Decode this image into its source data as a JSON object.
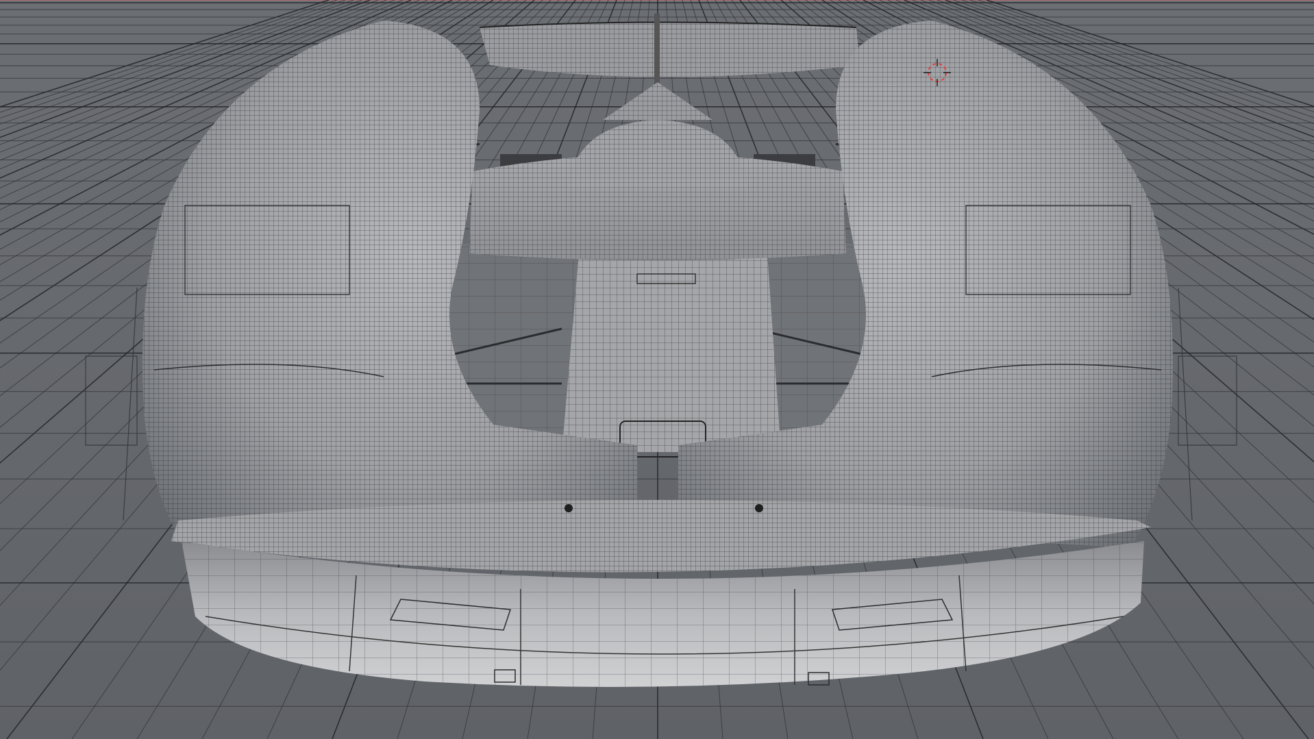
{
  "viewport": {
    "name": "3d-viewport",
    "shading": "wireframe-on-shaded",
    "colors": {
      "background": "#676a6f",
      "floor_grid": "#2f3135",
      "floor_grid_major": "#1e2023",
      "mesh_fill": "#a9abae",
      "mesh_shadow": "#7e8185",
      "wire": "#2a2c2f",
      "cursor": "#e04040",
      "highlight": "#c8cacd"
    }
  },
  "scene": {
    "object": "race-car-rear-body",
    "cursor_icon": "3d-cursor-icon"
  }
}
